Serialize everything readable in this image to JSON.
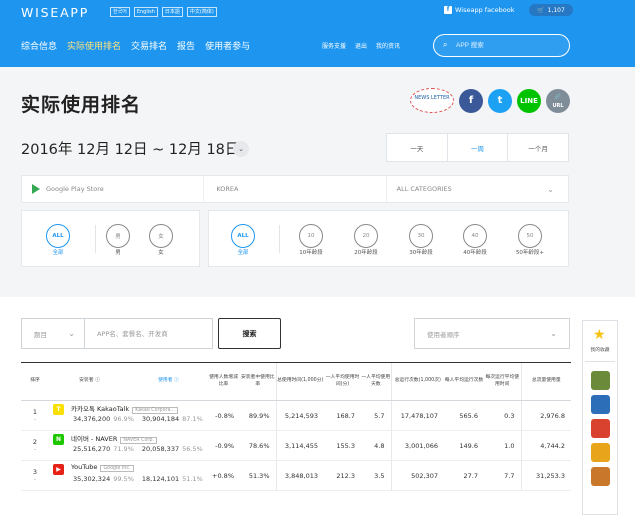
{
  "header": {
    "logo": "WISEAPP",
    "languages": [
      "한국어",
      "English",
      "日本語",
      "中文(简体)"
    ],
    "facebook_link": "Wiseapp facebook",
    "cart_count": "1,107",
    "nav": [
      {
        "label": "综合信息",
        "active": false
      },
      {
        "label": "实际使用排名",
        "active": true
      },
      {
        "label": "交易排名",
        "active": false
      },
      {
        "label": "报告",
        "active": false
      },
      {
        "label": "使用者参与",
        "active": false
      }
    ],
    "subnav": [
      "服务支援",
      "退出",
      "我的资讯"
    ],
    "search_placeholder": "APP 搜索"
  },
  "page": {
    "title": "实际使用排名",
    "newsletter": "NEWS LETTER",
    "share": {
      "facebook": "f",
      "twitter": "t",
      "line": "LINE",
      "url": "URL"
    }
  },
  "date_range": "2016年 12月 12日 ~ 12月 18日",
  "periods": [
    {
      "label": "一天",
      "active": false
    },
    {
      "label": "一周",
      "active": true
    },
    {
      "label": "一个月",
      "active": false
    }
  ],
  "filters": {
    "store": "Google Play Store",
    "country": "KOREA",
    "category": "ALL CATEGORIES"
  },
  "gender": [
    {
      "circle": "ALL",
      "label": "全部",
      "active": true
    },
    {
      "circle": "男",
      "label": "男",
      "active": false
    },
    {
      "circle": "女",
      "label": "女",
      "active": false
    }
  ],
  "age": [
    {
      "circle": "ALL",
      "label": "全部",
      "active": true
    },
    {
      "circle": "10",
      "label": "10年龄段",
      "active": false
    },
    {
      "circle": "20",
      "label": "20年龄段",
      "active": false
    },
    {
      "circle": "30",
      "label": "30年龄段",
      "active": false
    },
    {
      "circle": "40",
      "label": "40年龄段",
      "active": false
    },
    {
      "circle": "50",
      "label": "50年龄段+",
      "active": false
    }
  ],
  "search_form": {
    "genre": "题目",
    "query_placeholder": "APP名、套餐名、开发商",
    "button": "搜索",
    "sort": "使用者顺序"
  },
  "table": {
    "headers": [
      "排序",
      "安装者",
      "使用者",
      "使用人数增减比率",
      "安装者中使用比率",
      "总使用时间(1,000分)",
      "一人平均使用时间(分)",
      "一人平均使用天数",
      "总运行次数(1,000次)",
      "每人平均运行次数",
      "每次运行平均使用时间",
      "总流量使用量"
    ],
    "rows": [
      {
        "rank": "1",
        "delta": "-",
        "icon_color": "#f9e000",
        "icon_glyph": "T",
        "app": "카카오톡 KakaoTalk",
        "corp": "Kakao Corpora...",
        "installs": "34,376,200",
        "install_pct": "96.9%",
        "users": "30,904,184",
        "user_pct": "87.1%",
        "change": "-0.8%",
        "change_dir": "grow",
        "use_ratio": "89.9%",
        "total_time": "5,214,593",
        "avg_time": "168.7",
        "avg_days": "5.7",
        "total_runs": "17,478,107",
        "avg_runs": "565.6",
        "time_per_run": "0.3",
        "traffic": "2,976.8"
      },
      {
        "rank": "2",
        "delta": "-",
        "icon_color": "#1ec800",
        "icon_glyph": "N",
        "app": "네이버 - NAVER",
        "corp": "NAVER Corp.",
        "installs": "25,516,270",
        "install_pct": "71.9%",
        "users": "20,058,337",
        "user_pct": "56.5%",
        "change": "-0.9%",
        "change_dir": "grow",
        "use_ratio": "78.6%",
        "total_time": "3,114,455",
        "avg_time": "155.3",
        "avg_days": "4.8",
        "total_runs": "3,001,066",
        "avg_runs": "149.6",
        "time_per_run": "1.0",
        "traffic": "4,744.2"
      },
      {
        "rank": "3",
        "delta": "-",
        "icon_color": "#e62117",
        "icon_glyph": "▶",
        "app": "YouTube",
        "corp": "Google Inc.",
        "installs": "35,302,324",
        "install_pct": "99.5%",
        "users": "18,124,101",
        "user_pct": "51.1%",
        "change": "+0.8%",
        "change_dir": "fall",
        "use_ratio": "51.3%",
        "total_time": "3,848,013",
        "avg_time": "212.3",
        "avg_days": "3.5",
        "total_runs": "502,307",
        "avg_runs": "27.7",
        "time_per_run": "7.7",
        "traffic": "31,253.3"
      }
    ]
  },
  "rail": {
    "label": "我的收藏",
    "app_colors": [
      "#6b8a3a",
      "#2c6fb8",
      "#d8422e",
      "#e8a41a",
      "#c9782b"
    ]
  }
}
